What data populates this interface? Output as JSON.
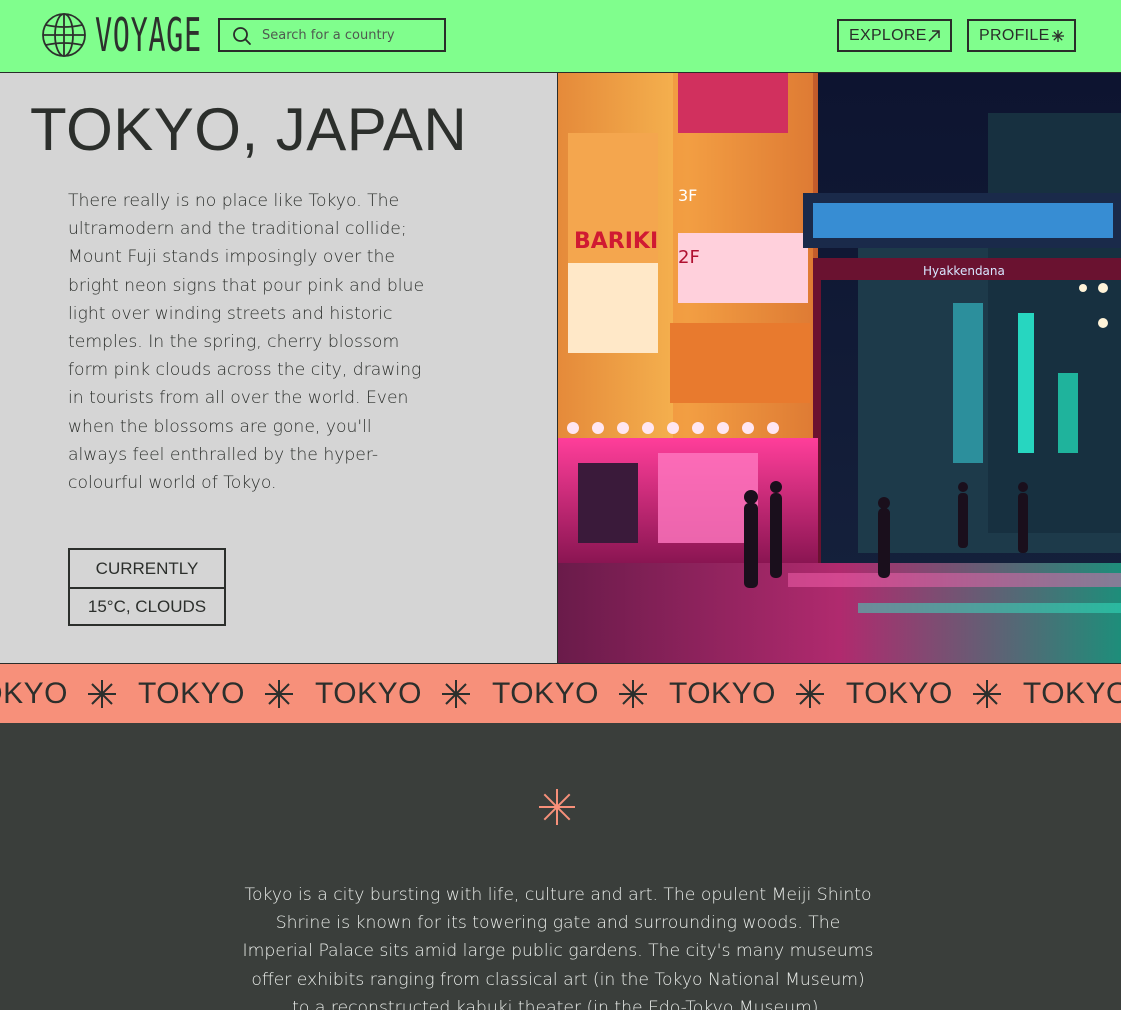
{
  "brand": {
    "name": "VOYAGE",
    "logo_icon": "globe-icon"
  },
  "search": {
    "placeholder": "Search for a country",
    "value": "",
    "icon": "search-icon"
  },
  "nav": {
    "explore_label": "EXPLORE",
    "explore_icon": "arrow-up-right-icon",
    "profile_label": "PROFILE",
    "profile_icon": "asterisk-icon"
  },
  "city": {
    "title": "TOKYO, JAPAN",
    "intro": "There really is no place like Tokyo. The ultramodern and the traditional collide; Mount Fuji stands imposingly over the bright neon signs that pour pink and blue light over winding streets and historic temples. In the spring, cherry blossom form pink clouds across the city, drawing in tourists from all over the world. Even when the blossoms are gone, you'll always feel enthralled by the hyper-colourful world of Tokyo."
  },
  "weather": {
    "label": "CURRENTLY",
    "value": "15°C, CLOUDS"
  },
  "hero_image": {
    "subject": "neon-lit Tokyo street at night"
  },
  "marquee": {
    "items": [
      "TOKYO",
      "TOKYO",
      "TOKYO",
      "TOKYO",
      "TOKYO",
      "TOKYO",
      "TOKYO"
    ],
    "separator_icon": "asterisk-icon"
  },
  "details": {
    "text": "Tokyo is a city bursting with life, culture and art. The opulent Meiji Shinto Shrine is known for its towering gate and surrounding woods. The Imperial Palace sits amid large public gardens. The city's many museums offer exhibits ranging from classical art (in the Tokyo National Museum) to a reconstructed kabuki theater (in the Edo-Tokyo Museum)."
  },
  "colors": {
    "header_bg": "#80fe8d",
    "panel_bg": "#d5d5d5",
    "marquee_bg": "#f7907a",
    "dark_bg": "#3a3e3b",
    "accent_star": "#f7907a",
    "ink": "#2c2f2c"
  }
}
